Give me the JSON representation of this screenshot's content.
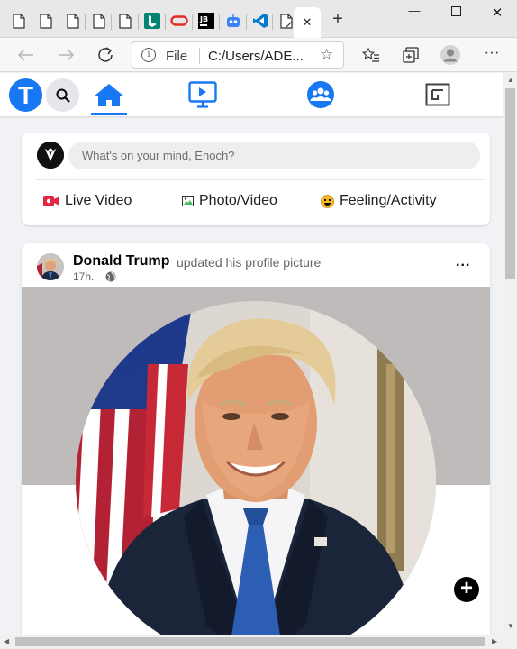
{
  "browser": {
    "file_label": "File",
    "url": "C:/Users/ADE...",
    "new_tab": "+",
    "tab_close": "✕"
  },
  "composer": {
    "placeholder": "What's on your mind, Enoch?",
    "actions": [
      {
        "label": "Live Video",
        "icon": "live-video-icon",
        "color": "#e42645"
      },
      {
        "label": "Photo/Video",
        "icon": "photo-icon",
        "color": "#45bd62"
      },
      {
        "label": "Feeling/Activity",
        "icon": "feeling-icon",
        "color": "#f7b928"
      }
    ]
  },
  "post": {
    "author": "Donald Trump",
    "action_text": "updated his profile picture",
    "time": "17h.",
    "more": "...",
    "plus": "+"
  },
  "colors": {
    "brand": "#1877f2",
    "cover": "#bfbbbb"
  }
}
